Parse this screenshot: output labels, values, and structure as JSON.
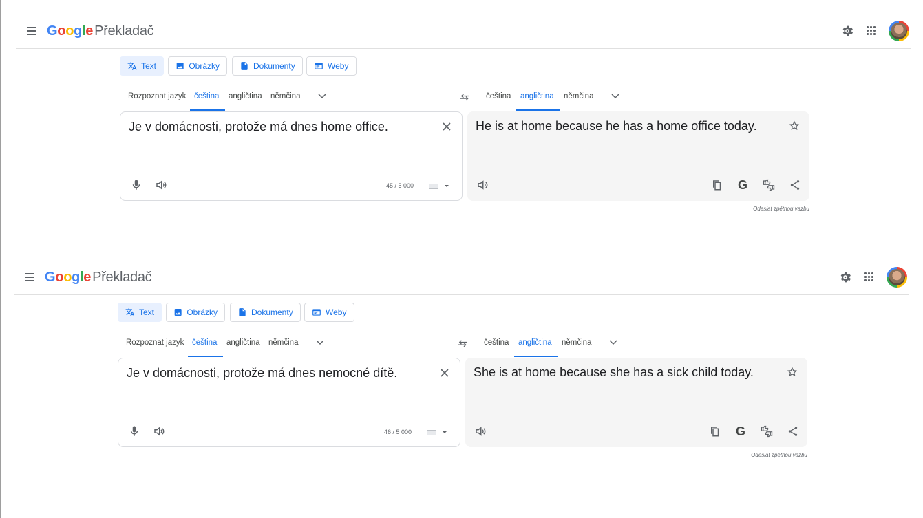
{
  "app": {
    "logo_parts": [
      "G",
      "o",
      "o",
      "g",
      "l",
      "e"
    ],
    "product": "Překladač"
  },
  "type_tabs": [
    "Text",
    "Obrázky",
    "Dokumenty",
    "Weby"
  ],
  "source_langs": [
    "Rozpoznat jazyk",
    "čeština",
    "angličtina",
    "němčina"
  ],
  "target_langs": [
    "čeština",
    "angličtina",
    "němčina"
  ],
  "selected_source": "čeština",
  "selected_target": "angličtina",
  "panels": [
    {
      "source_text": "Je v domácnosti, protože má dnes home office.",
      "target_text": "He is at home because he has a home office today.",
      "char_count": "45 / 5 000",
      "feedback": "Odeslat zpětnou vazbu"
    },
    {
      "source_text": "Je v domácnosti, protože má dnes nemocné dítě.",
      "target_text": "She is at home because she has a sick child today.",
      "char_count": "46 / 5 000",
      "feedback": "Odeslat zpětnou vazbu"
    }
  ],
  "colors": {
    "accent": "#1a73e8",
    "target_bg": "#f5f5f5"
  }
}
